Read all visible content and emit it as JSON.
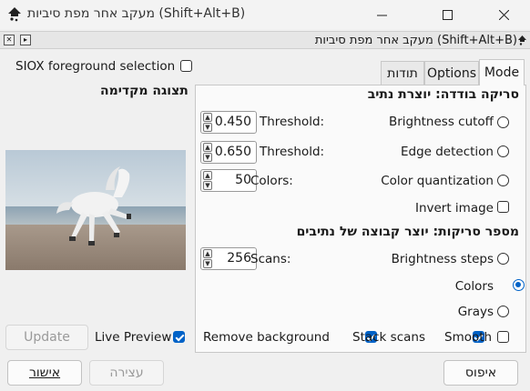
{
  "window": {
    "title": "מעקב אחר מפת סיביות (Shift+Alt+B)",
    "controls": [
      "minimize",
      "maximize",
      "close"
    ]
  },
  "dock": {
    "title": "מעקב אחר מפת סיביות (Shift+Alt+B)"
  },
  "left": {
    "siox_label": "SIOX foreground selection",
    "siox_checked": false,
    "preview_title": "תצוגה מקדימה",
    "update_label": "Update",
    "live_preview_label": "Live Preview",
    "live_preview_checked": true
  },
  "tabs": [
    {
      "label": "Mode",
      "active": true
    },
    {
      "label": "Options",
      "active": false
    },
    {
      "label": "תודות",
      "active": false
    }
  ],
  "single_scan": {
    "title": "סריקה בודדה: יוצרת נתיב",
    "brightness": {
      "label": "Brightness cutoff",
      "threshold_label": "Threshold:",
      "value": "0.450",
      "selected": false
    },
    "edge": {
      "label": "Edge detection",
      "threshold_label": "Threshold:",
      "value": "0.650",
      "selected": false
    },
    "quant": {
      "label": "Color quantization",
      "colors_label": "Colors:",
      "value": "50",
      "selected": false
    },
    "invert": {
      "label": "Invert image",
      "checked": false
    }
  },
  "multi_scan": {
    "title": "מספר סריקות: יוצר קבוצה של נתיבים",
    "scans_label": "Scans:",
    "scans_value": "256",
    "brightness_steps": {
      "label": "Brightness steps",
      "selected": false
    },
    "colors": {
      "label": "Colors",
      "selected": true
    },
    "grays": {
      "label": "Grays",
      "selected": false
    }
  },
  "options_row": {
    "remove_bg": {
      "label": "Remove background",
      "checked": true
    },
    "stack": {
      "label": "Stack scans",
      "checked": true
    },
    "smooth": {
      "label": "Smooth",
      "checked": false
    }
  },
  "footer": {
    "ok_label": "אישור",
    "stop_label": "עצירה",
    "reset_label": "איפוס"
  },
  "colors": {
    "accent": "#0062c7"
  }
}
